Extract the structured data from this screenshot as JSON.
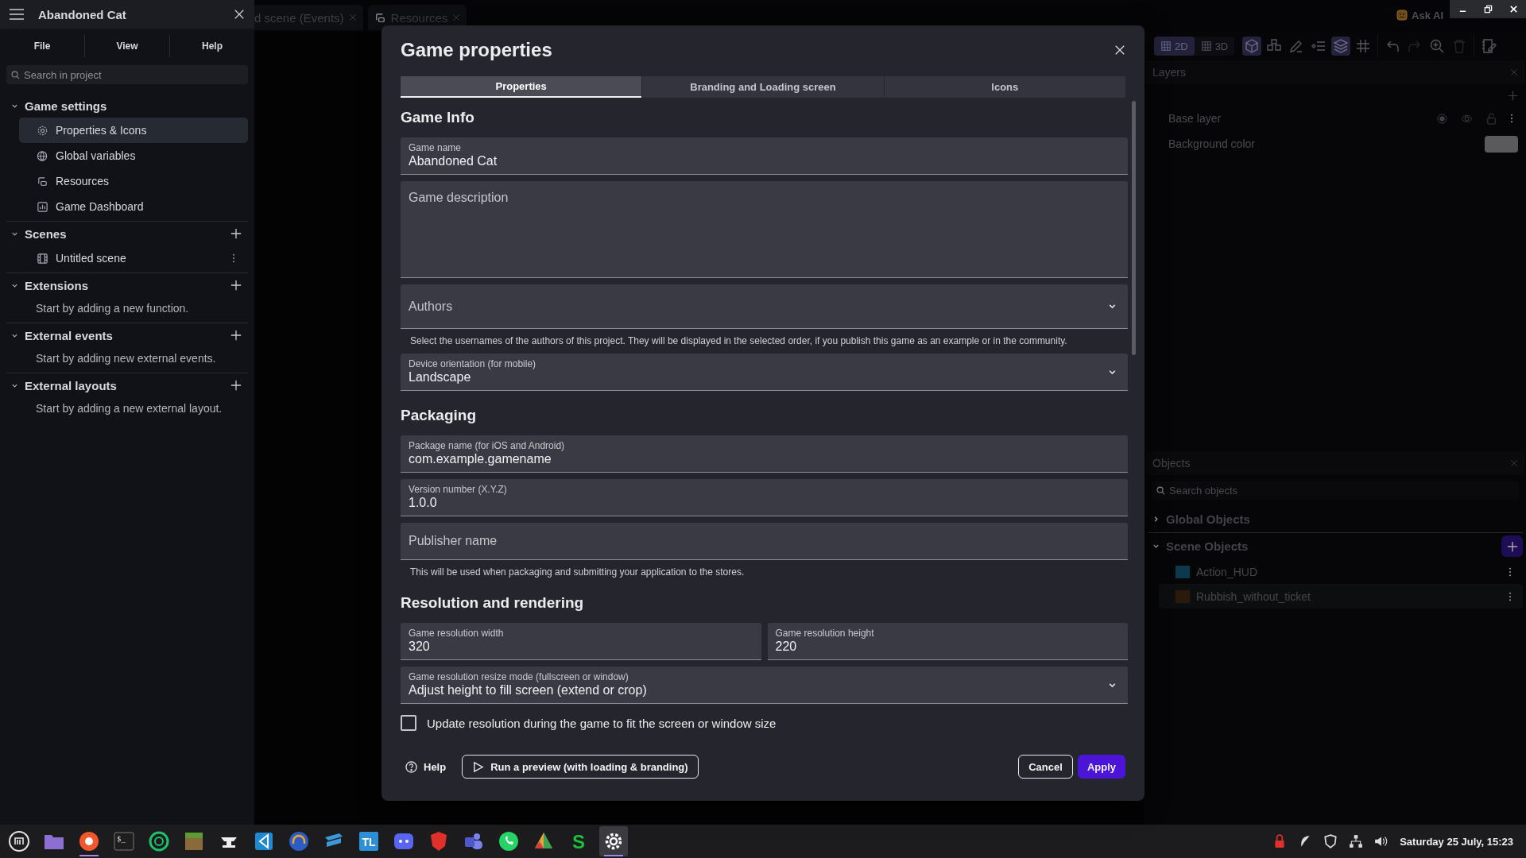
{
  "sidebar": {
    "title": "Abandoned Cat",
    "menu": [
      "File",
      "View",
      "Help"
    ],
    "search_placeholder": "Search in project",
    "sections": [
      {
        "title": "Game settings",
        "expanded": true,
        "addable": false,
        "items": [
          {
            "label": "Properties & Icons",
            "kind": "gear",
            "selected": true,
            "more_menu": false
          },
          {
            "label": "Global variables",
            "kind": "globe",
            "selected": false,
            "more_menu": false
          },
          {
            "label": "Resources",
            "kind": "resources",
            "selected": false,
            "more_menu": false
          },
          {
            "label": "Game Dashboard",
            "kind": "chart",
            "selected": false,
            "more_menu": false
          }
        ]
      },
      {
        "title": "Scenes",
        "expanded": true,
        "addable": true,
        "items": [
          {
            "label": "Untitled scene",
            "kind": "film",
            "selected": false,
            "more_menu": true
          }
        ]
      },
      {
        "title": "Extensions",
        "expanded": true,
        "addable": true,
        "empty": "Start by adding a new function."
      },
      {
        "title": "External events",
        "expanded": true,
        "addable": true,
        "empty": "Start by adding new external events."
      },
      {
        "title": "External layouts",
        "expanded": true,
        "addable": true,
        "empty": "Start by adding a new external layout."
      }
    ]
  },
  "top_bar": {
    "editor_tabs": [
      {
        "label": "d scene (Events)",
        "kind": "plain"
      },
      {
        "label": "Resources",
        "kind": "resources"
      }
    ],
    "ask_ai": "Ask AI"
  },
  "dialog": {
    "title": "Game properties",
    "tabs": [
      {
        "label": "Properties",
        "selected": true
      },
      {
        "label": "Branding and Loading screen",
        "selected": false
      },
      {
        "label": "Icons",
        "selected": false
      }
    ],
    "sections": [
      {
        "heading": "Game Info",
        "fields": [
          {
            "kind": "text",
            "label": "Game name",
            "value": "Abandoned Cat"
          },
          {
            "kind": "textarea",
            "placeholder": "Game description"
          },
          {
            "kind": "select",
            "placeholder": "Authors"
          },
          {
            "kind": "helper",
            "text": "Select the usernames of the authors of this project. They will be displayed in the selected order, if you publish this game as an example or in the community."
          },
          {
            "kind": "select",
            "label": "Device orientation (for mobile)",
            "value": "Landscape"
          }
        ]
      },
      {
        "heading": "Packaging",
        "fields": [
          {
            "kind": "text",
            "label": "Package name (for iOS and Android)",
            "value": "com.example.gamename"
          },
          {
            "kind": "text",
            "label": "Version number (X.Y.Z)",
            "value": "1.0.0"
          },
          {
            "kind": "text",
            "placeholder": "Publisher name"
          },
          {
            "kind": "helper",
            "text": "This will be used when packaging and submitting your application to the stores."
          }
        ]
      },
      {
        "heading": "Resolution and rendering",
        "fields": [
          {
            "kind": "pair",
            "fields": [
              {
                "kind": "text",
                "label": "Game resolution width",
                "value": "320"
              },
              {
                "kind": "text",
                "label": "Game resolution height",
                "value": "220"
              }
            ]
          },
          {
            "kind": "select",
            "label": "Game resolution resize mode (fullscreen or window)",
            "value": "Adjust height to fill screen (extend or crop)"
          },
          {
            "kind": "checkbox",
            "label": "Update resolution during the game to fit the screen or window size",
            "checked": false
          }
        ]
      }
    ],
    "footer": {
      "help": "Help",
      "preview": "Run a preview (with loading & branding)",
      "cancel": "Cancel",
      "apply": "Apply"
    }
  },
  "right_panel": {
    "view_modes": [
      {
        "label": "2D",
        "selected": true
      },
      {
        "label": "3D",
        "selected": false
      }
    ],
    "tools": [
      {
        "kind": "cube",
        "selected": true,
        "disabled": false
      },
      {
        "kind": "cubes",
        "selected": false,
        "disabled": false
      },
      {
        "kind": "pencil",
        "selected": false,
        "disabled": false
      },
      {
        "kind": "list",
        "selected": false,
        "disabled": false
      },
      {
        "kind": "layers",
        "selected": true,
        "disabled": false
      },
      {
        "kind": "grid",
        "selected": false,
        "disabled": false
      },
      {
        "kind": "undo",
        "selected": false,
        "disabled": false
      },
      {
        "kind": "redo",
        "selected": false,
        "disabled": true
      },
      {
        "kind": "zoom",
        "selected": false,
        "disabled": false
      },
      {
        "kind": "trash",
        "selected": false,
        "disabled": true
      },
      {
        "kind": "notes",
        "selected": false,
        "disabled": false
      }
    ],
    "layers": {
      "title": "Layers",
      "rows": [
        {
          "kind": "layer",
          "label": "Base layer"
        },
        {
          "kind": "color",
          "label": "Background color"
        }
      ]
    },
    "objects": {
      "title": "Objects",
      "search_placeholder": "Search objects",
      "groups": [
        {
          "title": "Global Objects",
          "expanded": false,
          "addable": false
        },
        {
          "title": "Scene Objects",
          "expanded": true,
          "addable": true,
          "items": [
            {
              "label": "Action_HUD",
              "selected": false
            },
            {
              "label": "Rubbish_without_ticket",
              "selected": true
            }
          ]
        }
      ]
    }
  },
  "taskbar": {
    "apps": [
      {
        "kind": "logo",
        "running": false,
        "selected": false
      },
      {
        "kind": "folder",
        "running": false,
        "selected": false
      },
      {
        "kind": "browser",
        "running": true,
        "selected": false
      },
      {
        "kind": "terminal",
        "text": "$_",
        "running": false,
        "selected": false
      },
      {
        "kind": "sync",
        "running": false,
        "selected": false
      },
      {
        "kind": "block",
        "running": false,
        "selected": false
      },
      {
        "kind": "anvil",
        "running": false,
        "selected": false
      },
      {
        "kind": "code",
        "running": false,
        "selected": false
      },
      {
        "kind": "headphones",
        "running": false,
        "selected": false
      },
      {
        "kind": "desk",
        "running": false,
        "selected": false
      },
      {
        "kind": "letters",
        "text": "TL",
        "running": false,
        "selected": false
      },
      {
        "kind": "chat",
        "running": false,
        "selected": false
      },
      {
        "kind": "shield",
        "running": false,
        "selected": false
      },
      {
        "kind": "people",
        "running": false,
        "selected": false
      },
      {
        "kind": "phone",
        "running": false,
        "selected": false
      },
      {
        "kind": "triangle",
        "running": false,
        "selected": false
      },
      {
        "kind": "glyph",
        "text": "S",
        "running": false,
        "selected": false
      },
      {
        "kind": "gear",
        "running": true,
        "selected": true
      }
    ],
    "clock": "Saturday 25 July, 15:23"
  }
}
